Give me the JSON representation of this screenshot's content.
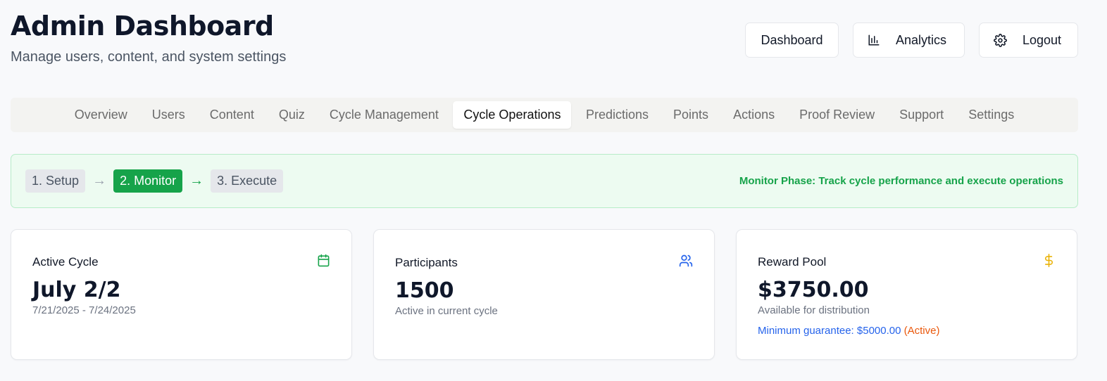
{
  "header": {
    "title": "Admin Dashboard",
    "subtitle": "Manage users, content, and system settings"
  },
  "top_buttons": {
    "dashboard": "Dashboard",
    "analytics": "Analytics",
    "logout": "Logout"
  },
  "tabs": [
    {
      "label": "Overview"
    },
    {
      "label": "Users"
    },
    {
      "label": "Content"
    },
    {
      "label": "Quiz"
    },
    {
      "label": "Cycle Management"
    },
    {
      "label": "Cycle Operations",
      "active": true
    },
    {
      "label": "Predictions"
    },
    {
      "label": "Points"
    },
    {
      "label": "Actions"
    },
    {
      "label": "Proof Review"
    },
    {
      "label": "Support"
    },
    {
      "label": "Settings"
    }
  ],
  "phase": {
    "steps": [
      "1. Setup",
      "2. Monitor",
      "3. Execute"
    ],
    "arrows": [
      "→",
      "→"
    ],
    "active_step": "2. Monitor",
    "message": "Monitor Phase: Track cycle performance and execute operations"
  },
  "cards": {
    "active_cycle": {
      "label": "Active Cycle",
      "value": "July 2/2",
      "sub": "7/21/2025 - 7/24/2025",
      "icon": "calendar-icon"
    },
    "participants": {
      "label": "Participants",
      "value": "1500",
      "sub": "Active in current cycle",
      "icon": "users-icon"
    },
    "reward_pool": {
      "label": "Reward Pool",
      "value": "$3750.00",
      "sub": "Available for distribution",
      "note": "Minimum guarantee: $5000.00",
      "note_status": "(Active)",
      "icon": "dollar-icon"
    }
  },
  "colors": {
    "accent_green": "#16a34a",
    "accent_blue": "#2563eb",
    "accent_orange": "#ea580c",
    "accent_yellow": "#eab308"
  }
}
